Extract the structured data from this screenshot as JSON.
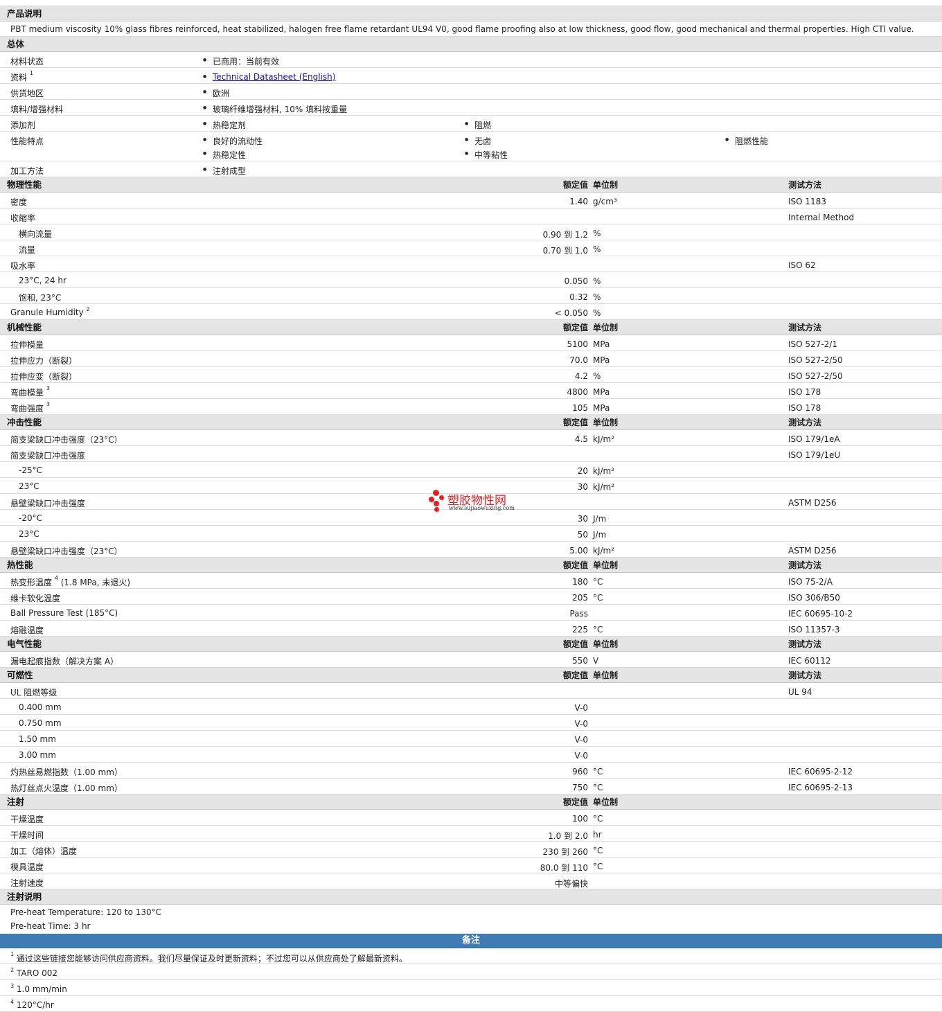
{
  "product": {
    "header": "产品说明",
    "description": "PBT medium viscosity 10% glass fibres reinforced, heat stabilized, halogen free flame retardant UL94 V0, good flame proofing also at low thickness, good flow, good mechanical and thermal properties. High CTI value."
  },
  "general": {
    "header": "总体",
    "status_label": "材料状态",
    "status_value": "已商用：当前有效",
    "literature_label": "资料",
    "literature_sup": "1",
    "literature_link": "Technical Datasheet (English)",
    "availability_label": "供货地区",
    "availability_value": "欧洲",
    "filler_label": "填料/增强材料",
    "filler_value": "玻璃纤维增强材料, 10% 填料按重量",
    "additive_label": "添加剂",
    "additive_1": "热稳定剂",
    "additive_2": "阻燃",
    "features_label": "性能特点",
    "feature_1": "良好的流动性",
    "feature_2": "无卤",
    "feature_3": "阻燃性能",
    "feature_4": "热稳定性",
    "feature_5": "中等粘性",
    "processing_label": "加工方法",
    "processing_value": "注射成型"
  },
  "col": {
    "value": "额定值",
    "unit": "单位制",
    "test": "测试方法"
  },
  "physical": {
    "header": "物理性能",
    "rows": [
      {
        "label": "密度",
        "value": "1.40",
        "unit": "g/cm³",
        "test": "ISO 1183"
      },
      {
        "label": "收缩率",
        "value": "",
        "unit": "",
        "test": "Internal Method"
      },
      {
        "label": "横向流量",
        "value": "0.90 到  1.2",
        "unit": "%",
        "test": ""
      },
      {
        "label": "流量",
        "value": "0.70 到  1.0",
        "unit": "%",
        "test": ""
      },
      {
        "label": "吸水率",
        "value": "",
        "unit": "",
        "test": "ISO 62"
      },
      {
        "label": "23°C, 24 hr",
        "value": "0.050",
        "unit": "%",
        "test": ""
      },
      {
        "label": "饱和, 23°C",
        "value": "0.32",
        "unit": "%",
        "test": ""
      },
      {
        "label": "Granule Humidity",
        "sup": "2",
        "value": "< 0.050",
        "unit": "%",
        "test": ""
      }
    ]
  },
  "mechanical": {
    "header": "机械性能",
    "rows": [
      {
        "label": "拉伸模量",
        "value": "5100",
        "unit": "MPa",
        "test": "ISO 527-2/1"
      },
      {
        "label": "拉伸应力（断裂）",
        "value": "70.0",
        "unit": "MPa",
        "test": "ISO 527-2/50"
      },
      {
        "label": "拉伸应变（断裂）",
        "value": "4.2",
        "unit": "%",
        "test": "ISO 527-2/50"
      },
      {
        "label": "弯曲模量",
        "sup": "3",
        "value": "4800",
        "unit": "MPa",
        "test": "ISO 178"
      },
      {
        "label": "弯曲强度",
        "sup": "3",
        "value": "105",
        "unit": "MPa",
        "test": "ISO 178"
      }
    ]
  },
  "impact": {
    "header": "冲击性能",
    "rows": [
      {
        "label": "简支梁缺口冲击强度（23°C）",
        "value": "4.5",
        "unit": "kJ/m²",
        "test": "ISO 179/1eA"
      },
      {
        "label": "简支梁缺口冲击强度",
        "value": "",
        "unit": "",
        "test": "ISO 179/1eU"
      },
      {
        "label": "-25°C",
        "value": "20",
        "unit": "kJ/m²",
        "test": ""
      },
      {
        "label": "23°C",
        "value": "30",
        "unit": "kJ/m²",
        "test": ""
      },
      {
        "label": "悬壁梁缺口冲击强度",
        "value": "",
        "unit": "",
        "test": "ASTM D256"
      },
      {
        "label": "-20°C",
        "value": "30",
        "unit": "J/m",
        "test": ""
      },
      {
        "label": "23°C",
        "value": "50",
        "unit": "J/m",
        "test": ""
      },
      {
        "label": "悬壁梁缺口冲击强度（23°C）",
        "value": "5.00",
        "unit": "kJ/m²",
        "test": "ASTM D256"
      }
    ]
  },
  "thermal": {
    "header": "热性能",
    "rows": [
      {
        "label": "热变形温度",
        "sup": "4",
        "label_suffix": " (1.8 MPa, 未退火)",
        "value": "180",
        "unit": "°C",
        "test": "ISO 75-2/A"
      },
      {
        "label": "维卡软化温度",
        "value": "205",
        "unit": "°C",
        "test": "ISO 306/B50"
      },
      {
        "label": "Ball Pressure Test (185°C)",
        "value": "Pass",
        "unit": "",
        "test": "IEC 60695-10-2"
      },
      {
        "label": "熔融温度",
        "value": "225",
        "unit": "°C",
        "test": "ISO 11357-3"
      }
    ]
  },
  "electrical": {
    "header": "电气性能",
    "rows": [
      {
        "label": "漏电起痕指数（解决方案 A）",
        "value": "550",
        "unit": "V",
        "test": "IEC 60112"
      }
    ]
  },
  "flammability": {
    "header": "可燃性",
    "rows": [
      {
        "label": "UL 阻燃等级",
        "value": "",
        "unit": "",
        "test": "UL 94"
      },
      {
        "label": "0.400 mm",
        "value": "V-0",
        "unit": "",
        "test": ""
      },
      {
        "label": "0.750 mm",
        "value": "V-0",
        "unit": "",
        "test": ""
      },
      {
        "label": "1.50 mm",
        "value": "V-0",
        "unit": "",
        "test": ""
      },
      {
        "label": "3.00 mm",
        "value": "V-0",
        "unit": "",
        "test": ""
      },
      {
        "label": "灼热丝易燃指数（1.00 mm）",
        "value": "960",
        "unit": "°C",
        "test": "IEC 60695-2-12"
      },
      {
        "label": "热灯丝点火温度（1.00 mm）",
        "value": "750",
        "unit": "°C",
        "test": "IEC 60695-2-13"
      }
    ]
  },
  "injection": {
    "header": "注射",
    "rows": [
      {
        "label": "干燥温度",
        "value": "100",
        "unit": "°C",
        "test": ""
      },
      {
        "label": "干燥时间",
        "value": "1.0 到  2.0",
        "unit": "hr",
        "test": ""
      },
      {
        "label": "加工（熔体）温度",
        "value": "230 到  260",
        "unit": "°C",
        "test": ""
      },
      {
        "label": "模具温度",
        "value": "80.0 到  110",
        "unit": "°C",
        "test": ""
      },
      {
        "label": "注射速度",
        "value": "中等偏快",
        "unit": "",
        "test": ""
      }
    ]
  },
  "injection_notes": {
    "header": "注射说明",
    "line_1": "Pre-heat Temperature: 120 to 130°C",
    "line_2": "Pre-heat Time: 3 hr"
  },
  "remarks": {
    "header": "备注",
    "notes": [
      {
        "num": "1",
        "text": "通过这些链接您能够访问供应商资料。我们尽量保证及时更新资料；不过您可以从供应商处了解最新资料。"
      },
      {
        "num": "2",
        "text": "TARO 002"
      },
      {
        "num": "3",
        "text": "1.0 mm/min"
      },
      {
        "num": "4",
        "text": "120°C/hr"
      }
    ]
  },
  "watermark": {
    "name": "塑胶物性网",
    "url": "www.sujiaowuxing.com",
    "color": "#e81e25"
  },
  "colors": {
    "header_bg": "#e4e4e4",
    "remarks_bg": "#3e7cb3",
    "link": "#1a0dab"
  }
}
